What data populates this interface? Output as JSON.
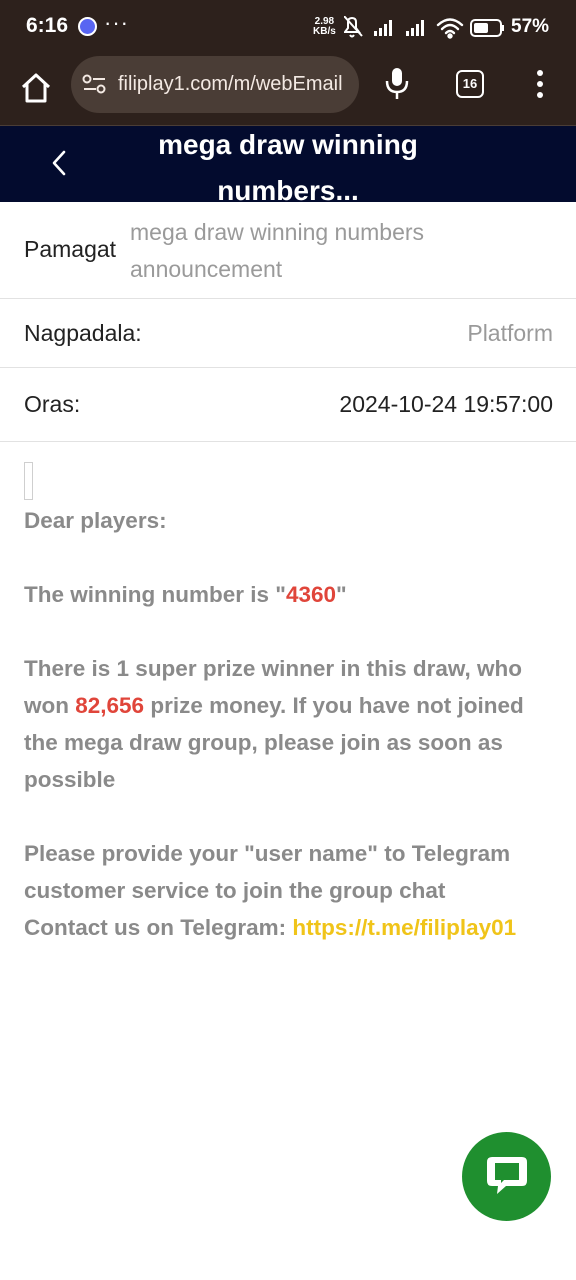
{
  "status_bar": {
    "time": "6:16",
    "dots": "···",
    "net_speed_value": "2.98",
    "net_speed_unit": "KB/s",
    "battery": "57%"
  },
  "browser": {
    "url": "filiplay1.com/m/webEmail",
    "tab_count": "16"
  },
  "header": {
    "title": "mega draw winning numbers..."
  },
  "mail": {
    "subject_label": "Pamagat",
    "subject_value": "mega draw winning numbers announcement",
    "sender_label": "Nagpadala:",
    "sender_value": "Platform",
    "time_label": "Oras:",
    "time_value": "2024-10-24 19:57:00"
  },
  "body": {
    "greeting": "Dear players:",
    "winning_prefix": "The winning number is \"",
    "winning_number": "4360",
    "winning_suffix": "\"",
    "prize_prefix": "There is 1 super prize winner in this draw, who won ",
    "prize_amount": "82,656",
    "prize_suffix": " prize money. If you have not joined the mega draw group, please join as soon as possible",
    "provide_text": "Please provide your \"user name\" to Telegram customer service to join the group chat",
    "contact_prefix": "Contact us on Telegram: ",
    "telegram_link": "https://t.me/filiplay01"
  },
  "colors": {
    "status_bg": "#2d211c",
    "header_bg": "#030b2e",
    "highlight_red": "#e0453a",
    "link_yellow": "#f0c419",
    "chat_green": "#1f8f2f"
  },
  "icons": {
    "home": "home-icon",
    "tune": "site-settings-icon",
    "mic": "mic-icon",
    "menu": "more-vert-icon",
    "back": "chevron-left-icon",
    "chat": "chat-bubble-icon"
  }
}
